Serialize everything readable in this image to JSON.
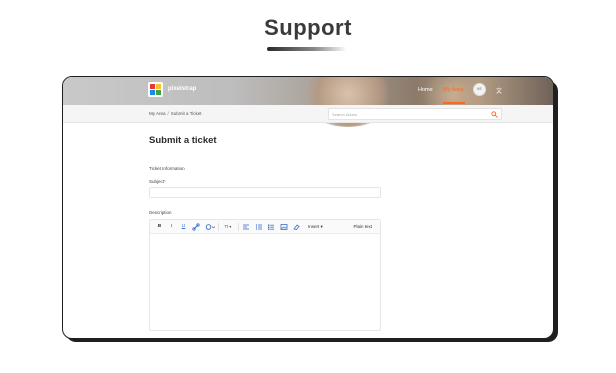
{
  "banner": {
    "title": "Support"
  },
  "header": {
    "brand": "pixelstrap",
    "nav": [
      {
        "label": "Home",
        "active": false
      },
      {
        "label": "My Area",
        "active": true
      }
    ],
    "avatar_initials": "KE",
    "language_icon": "translate-icon",
    "accent_color": "#ff6a1a"
  },
  "breadcrumb": {
    "items": [
      "My Area",
      "Submit a Ticket"
    ],
    "separator": "/"
  },
  "search": {
    "placeholder": "Search tickets",
    "icon": "search-icon"
  },
  "form": {
    "title": "Submit a ticket",
    "section": "Ticket Information",
    "subject_label": "Subject",
    "required_mark": "*",
    "subject_value": "",
    "description_label": "Description",
    "toolbar": {
      "bold": "B",
      "italic": "I",
      "underline": "U",
      "link_icon": "link-icon",
      "color_icon": "text-color-icon",
      "font_size": "Tt",
      "align_icon": "align-left-icon",
      "bullet_icon": "bullet-list-icon",
      "ordered_icon": "ordered-list-icon",
      "image_icon": "image-icon",
      "clear_icon": "eraser-icon",
      "insert_label": "Insert",
      "plain_text_label": "Plain text"
    },
    "description_value": ""
  }
}
